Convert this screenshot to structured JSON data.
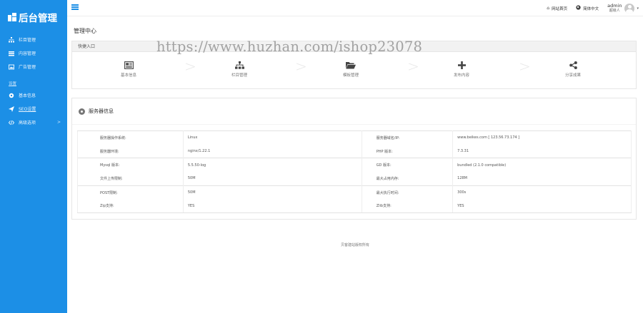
{
  "app": {
    "logo_text": "后台管理"
  },
  "sidebar": {
    "items": [
      {
        "label": "栏目管理",
        "icon": "sitemap-icon"
      },
      {
        "label": "内容管理",
        "icon": "list-icon"
      },
      {
        "label": "广告管理",
        "icon": "image-icon"
      }
    ],
    "section_label": "设置",
    "settings_items": [
      {
        "label": "基本信息",
        "icon": "gear-icon"
      },
      {
        "label": "SEO设置",
        "icon": "send-icon"
      },
      {
        "label": "高级选项",
        "icon": "code-icon"
      }
    ]
  },
  "topbar": {
    "site_home": "网站首页",
    "language": "简体中文",
    "user_name": "admin",
    "user_role": "超级人"
  },
  "page": {
    "title": "管理中心"
  },
  "quick": {
    "title": "快捷入口",
    "items": [
      {
        "label": "基本信息",
        "icon": "newspaper-icon"
      },
      {
        "label": "栏目管理",
        "icon": "sitemap-icon"
      },
      {
        "label": "模板管理",
        "icon": "folder-open-icon"
      },
      {
        "label": "发布内容",
        "icon": "plus-icon"
      },
      {
        "label": "分享成果",
        "icon": "share-icon"
      }
    ]
  },
  "watermark": "https://www.huzhan.com/ishop23078",
  "server": {
    "title": "服务器信息",
    "rows": [
      [
        "服务器操作系统:",
        "Linux",
        "服务器域名/IP:",
        "www.beikes.com [ 123.56.73.174 ]"
      ],
      [
        "服务器环境:",
        "nginx/1.22.1",
        "PHP 版本:",
        "7.3.31"
      ],
      [
        "Mysql 版本:",
        "5.5.50-log",
        "GD 版本:",
        "bundled (2.1.0 compatible)"
      ],
      [
        "文件上传限制:",
        "50M",
        "最大占用内存:",
        "128M"
      ],
      [
        "POST限制:",
        "50M",
        "最大执行时间:",
        "300s"
      ],
      [
        "Zip支持:",
        "YES",
        "Zlib支持:",
        "YES"
      ]
    ]
  },
  "footer": {
    "text": "贝客建站版权所有"
  }
}
